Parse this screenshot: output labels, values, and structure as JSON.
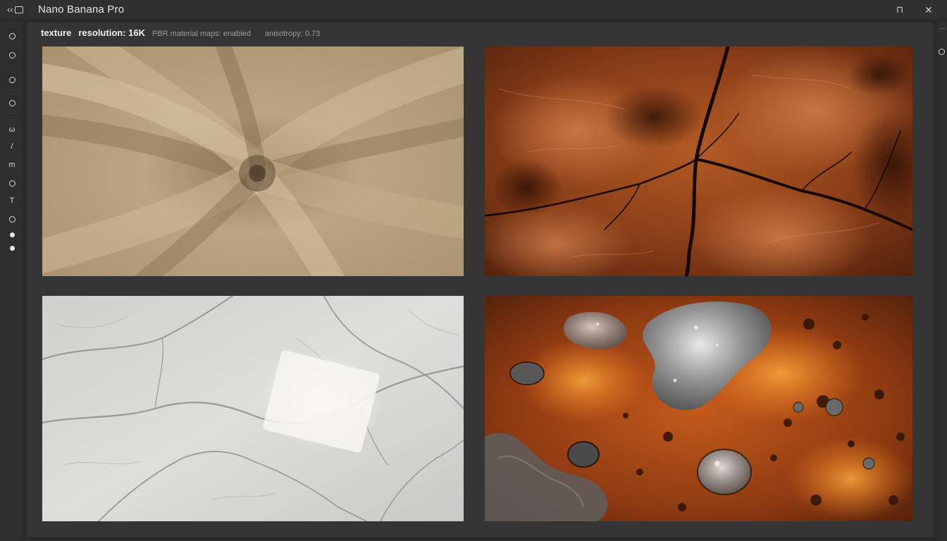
{
  "window": {
    "title": "Nano Banana Pro",
    "nav_back_glyph": "‹‹",
    "pin_glyph": "⊓",
    "close_glyph": "✕"
  },
  "infobar": {
    "label": "texture",
    "resolution": "resolution: 16K",
    "maps": "PBR material maps: enabled",
    "anisotropy": "anisotropy: 0.73"
  },
  "toolbar": {
    "tools": [
      {
        "name": "select-tool-icon",
        "kind": "ring"
      },
      {
        "name": "brush-tool-icon",
        "kind": "ring"
      },
      {
        "name": "fill-tool-icon",
        "kind": "ring"
      },
      {
        "name": "drop-tool-icon",
        "kind": "ring"
      },
      {
        "name": "warp-tool-icon",
        "kind": "glyph",
        "glyph": "ω"
      },
      {
        "name": "line-tool-icon",
        "kind": "glyph",
        "glyph": "/"
      },
      {
        "name": "mask-tool-icon",
        "kind": "glyph",
        "glyph": "m"
      },
      {
        "name": "sample-tool-icon",
        "kind": "ring"
      },
      {
        "name": "text-tool-icon",
        "kind": "glyph",
        "glyph": "T"
      },
      {
        "name": "blur-tool-icon",
        "kind": "ring"
      },
      {
        "name": "primary-color-icon",
        "kind": "dot"
      },
      {
        "name": "secondary-color-icon",
        "kind": "dot"
      }
    ]
  },
  "tiles": [
    {
      "name": "fabric-texture-tile",
      "material": "woven fabric"
    },
    {
      "name": "leather-texture-tile",
      "material": "cracked leather"
    },
    {
      "name": "marble-texture-tile",
      "material": "white marble"
    },
    {
      "name": "rust-texture-tile",
      "material": "rusted metal"
    }
  ],
  "colors": {
    "bg": "#2b2b2b",
    "panel": "#353535",
    "fabric": "#c2ab88",
    "leather": "#8a3e18",
    "marble": "#dcdcda",
    "rust": "#b4501a"
  }
}
